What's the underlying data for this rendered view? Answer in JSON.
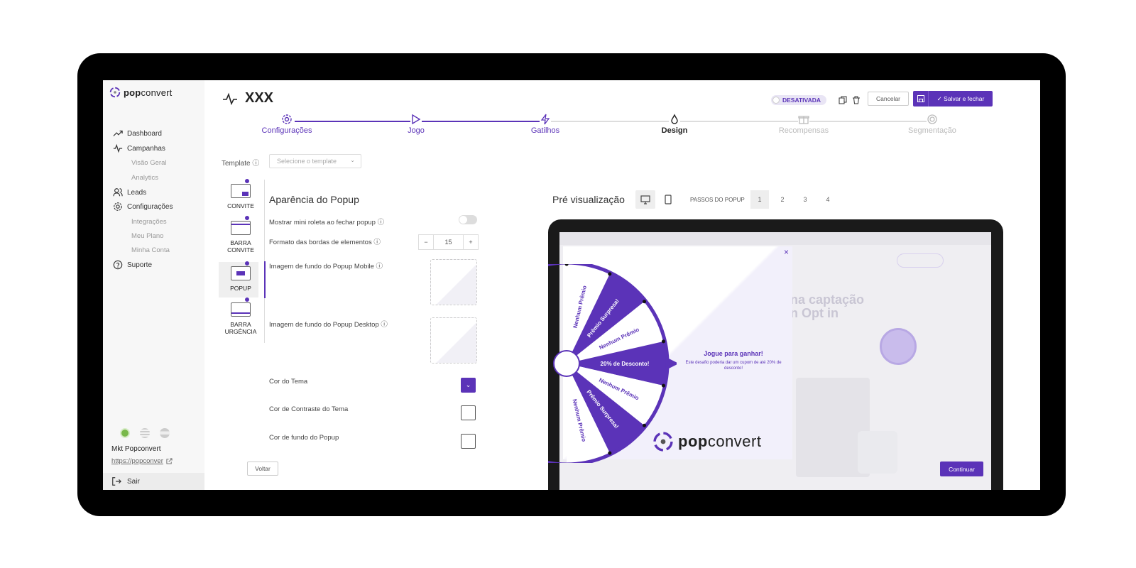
{
  "app": {
    "logo_pop": "pop",
    "logo_convert": "convert",
    "campaign_title": "XXX"
  },
  "sidebar": {
    "items": [
      {
        "label": "Dashboard"
      },
      {
        "label": "Campanhas"
      },
      {
        "label": "Leads"
      },
      {
        "label": "Configurações"
      },
      {
        "label": "Suporte"
      }
    ],
    "subitems": {
      "campanhas": [
        "Visão Geral",
        "Analytics"
      ],
      "config": [
        "Integrações",
        "Meu Plano",
        "Minha Conta"
      ]
    },
    "org_name": "Mkt Popconvert",
    "org_url": "https://popconver",
    "logout": "Sair"
  },
  "header": {
    "status": "DESATIVADA",
    "cancel": "Cancelar",
    "save": "✓ Salvar e fechar"
  },
  "steps": [
    {
      "label": "Configurações"
    },
    {
      "label": "Jogo"
    },
    {
      "label": "Gatilhos"
    },
    {
      "label": "Design"
    },
    {
      "label": "Recompensas"
    },
    {
      "label": "Segmentação"
    }
  ],
  "template": {
    "label": "Template",
    "placeholder": "Selecione o template"
  },
  "tabs": [
    {
      "label": "CONVITE"
    },
    {
      "label": "BARRA CONVITE"
    },
    {
      "label": "POPUP"
    },
    {
      "label": "BARRA URGÊNCIA"
    }
  ],
  "form": {
    "section_title": "Aparência do Popup",
    "mini_roleta": "Mostrar mini roleta ao fechar popup",
    "bordas": "Formato das bordas de elementos",
    "bordas_value": "15",
    "img_mobile": "Imagem de fundo do Popup Mobile",
    "img_desktop": "Imagem de fundo do Popup Desktop",
    "cor_tema": "Cor do Tema",
    "cor_contraste": "Cor de Contraste do Tema",
    "cor_fundo": "Cor de fundo do Popup"
  },
  "preview": {
    "title": "Pré visualização",
    "steps_label": "PASSOS DO POPUP",
    "pages": [
      "1",
      "2",
      "3",
      "4"
    ],
    "popup_title": "Jogue para ganhar!",
    "popup_desc": "Este desafio poderia dar um cupom de até 20% de desconto!",
    "wheel": [
      "Nenhum Prêmio",
      "Prêmio Surpresa!",
      "Nenhum Prêmio",
      "20% de Desconto!",
      "Nenhum Prêmio",
      "Prêmio Surpresa!",
      "Nenhum Prêmio"
    ],
    "bg_heading1": "na captação",
    "bg_heading2": "n Opt in",
    "popup_brand_pop": "pop",
    "popup_brand_convert": "convert"
  },
  "footer": {
    "back": "Voltar",
    "next": "Continuar"
  },
  "colors": {
    "accent": "#5b33b8",
    "light_accent": "#c9bcec"
  }
}
